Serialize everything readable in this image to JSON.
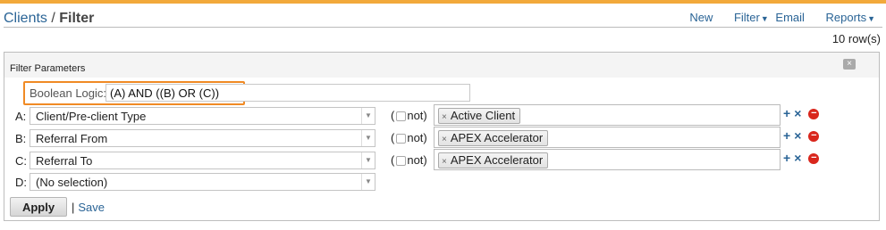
{
  "header": {
    "crumb_clients": "Clients",
    "crumb_sep": "/",
    "crumb_current": "Filter"
  },
  "actions": {
    "new": "New",
    "filter": "Filter",
    "email": "Email",
    "reports": "Reports"
  },
  "row_count": "10 row(s)",
  "panel": {
    "title": "Filter Parameters",
    "close": "×"
  },
  "boolean": {
    "label": "Boolean Logic:",
    "value": "(A) AND ((B) OR (C))"
  },
  "rows": [
    {
      "label": "A:",
      "field": "Client/Pre-client Type",
      "not_open": "(",
      "not_label": "not)",
      "tag": "Active Client"
    },
    {
      "label": "B:",
      "field": "Referral From",
      "not_open": "(",
      "not_label": "not)",
      "tag": "APEX Accelerator"
    },
    {
      "label": "C:",
      "field": "Referral To",
      "not_open": "(",
      "not_label": "not)",
      "tag": "APEX Accelerator"
    },
    {
      "label": "D:",
      "field": "(No selection)"
    }
  ],
  "icons": {
    "plus": "+",
    "times": "×",
    "minus": "−",
    "tag_remove": "×",
    "dropdown": "▼"
  },
  "footer": {
    "apply": "Apply",
    "divider": "|",
    "save": "Save"
  },
  "colors": {
    "accent": "#f2a93b",
    "highlight": "#f08a24",
    "link": "#2a6496",
    "remove": "#d9261c"
  }
}
